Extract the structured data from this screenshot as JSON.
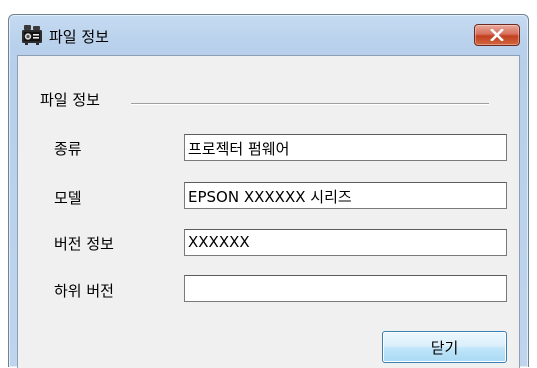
{
  "window": {
    "title": "파일 정보",
    "app_icon": "projector-icon",
    "close_icon": "close-icon"
  },
  "group": {
    "label": "파일 정보"
  },
  "fields": [
    {
      "label": "종류",
      "value": "프로젝터 펌웨어"
    },
    {
      "label": "모델",
      "value": "EPSON XXXXXX 시리즈"
    },
    {
      "label": "버전 정보",
      "value": "XXXXXX"
    },
    {
      "label": "하위 버전",
      "value": ""
    }
  ],
  "buttons": {
    "close_label": "닫기"
  },
  "colors": {
    "title_bar": "#c6dbf1",
    "close_button": "#c2401f",
    "dialog_background": "#f0f0f0",
    "action_button_border": "#3c7fb1"
  }
}
